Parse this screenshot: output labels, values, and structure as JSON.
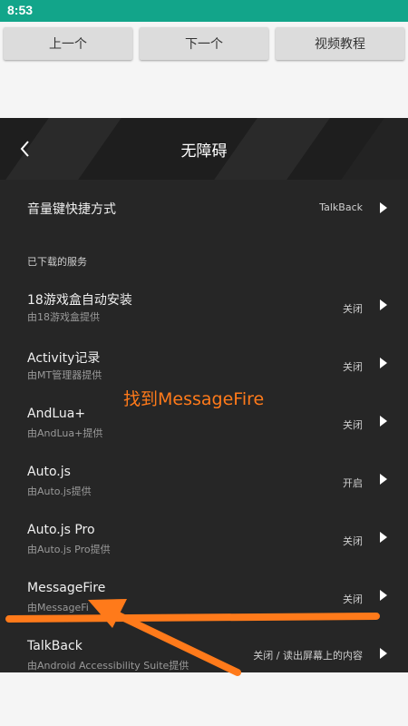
{
  "status_bar": {
    "time": "8:53"
  },
  "top_buttons": {
    "prev": "上一个",
    "next": "下一个",
    "tutorial": "视频教程"
  },
  "header": {
    "title": "无障碍"
  },
  "volume_shortcut": {
    "label": "音量键快捷方式",
    "value": "TalkBack"
  },
  "section": {
    "downloaded": "已下载的服务"
  },
  "services": [
    {
      "name": "18游戏盒自动安装",
      "provider": "由18游戏盒提供",
      "status": "关闭"
    },
    {
      "name": "Activity记录",
      "provider": "由MT管理器提供",
      "status": "关闭"
    },
    {
      "name": "AndLua+",
      "provider": "由AndLua+提供",
      "status": "关闭"
    },
    {
      "name": "Auto.js",
      "provider": "由Auto.js提供",
      "status": "开启"
    },
    {
      "name": "Auto.js Pro",
      "provider": "由Auto.js Pro提供",
      "status": "关闭"
    },
    {
      "name": "MessageFire",
      "provider": "由MessageFi",
      "status": "关闭"
    },
    {
      "name": "TalkBack",
      "provider": "由Android Accessibility Suite提供",
      "status": "关闭 / 读出屏幕上的内容"
    }
  ],
  "annotation": {
    "text": "找到MessageFire",
    "color": "#ff7a1a"
  }
}
